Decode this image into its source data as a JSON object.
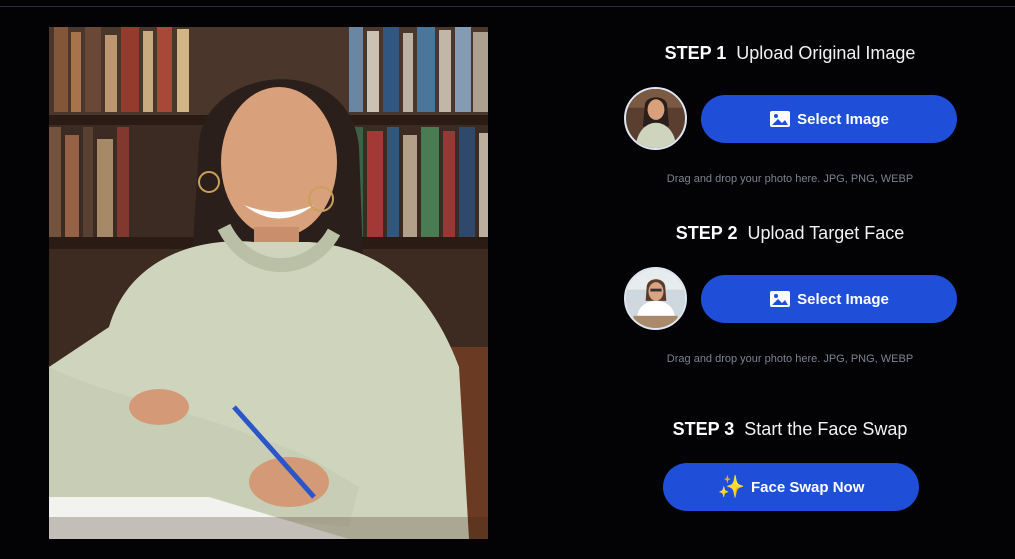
{
  "step1": {
    "number": "STEP 1",
    "title": "Upload Original Image",
    "button_label": "Select Image",
    "hint": "Drag and drop your photo here. JPG, PNG, WEBP"
  },
  "step2": {
    "number": "STEP 2",
    "title": "Upload Target Face",
    "button_label": "Select Image",
    "hint": "Drag and drop your photo here. JPG, PNG, WEBP"
  },
  "step3": {
    "number": "STEP 3",
    "title": "Start the Face Swap",
    "button_label": "Face Swap Now"
  },
  "icons": {
    "select_image": "image-icon",
    "face_swap": "sparkles-icon"
  },
  "colors": {
    "background": "#030305",
    "button": "#1f4fd8",
    "hint_text": "#7c8290"
  }
}
